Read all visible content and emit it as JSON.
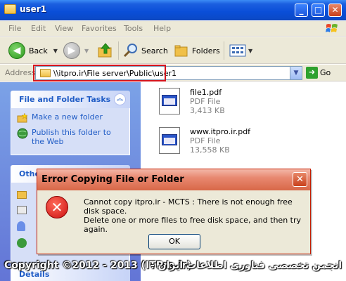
{
  "window": {
    "title": "user1",
    "minimize_glyph": "_",
    "maximize_glyph": "□",
    "close_glyph": "✕"
  },
  "menu": [
    "File",
    "Edit",
    "View",
    "Favorites",
    "Tools",
    "Help"
  ],
  "toolbar": {
    "back_label": "Back",
    "search_label": "Search",
    "folders_label": "Folders"
  },
  "address": {
    "label": "Address",
    "path": "\\\\itpro.ir\\File server\\Public\\user1",
    "go_label": "Go"
  },
  "tasks": {
    "header": "File and Folder Tasks",
    "items": [
      {
        "label": "Make a new folder",
        "icon": "new-folder-icon"
      },
      {
        "label": "Publish this folder to the Web",
        "icon": "publish-web-icon"
      }
    ],
    "other_header": "Other Places",
    "details_header": "Details"
  },
  "files": [
    {
      "name": "file1.pdf",
      "type": "PDF File",
      "size": "3,413 KB"
    },
    {
      "name": "www.itpro.ir.pdf",
      "type": "PDF File",
      "size": "13,558 KB"
    }
  ],
  "dialog": {
    "title": "Error Copying File or Folder",
    "message": "Cannot copy itpro.ir - MCTS : There is not enough free disk space.",
    "hint": "Delete one or more files to free disk space, and then try again.",
    "ok_label": "OK",
    "close_glyph": "✕"
  },
  "watermark": {
    "ltr": "Copyright ©2012 - 2013 (ITPro.ir)",
    "rtl": "انجمن تخصصی فناوری اطلاعات ایران -"
  },
  "colors": {
    "titlebar": "#0a4ed8",
    "dialog_border": "#c41c00",
    "highlight": "#d4141c",
    "task_link": "#215dc6"
  }
}
